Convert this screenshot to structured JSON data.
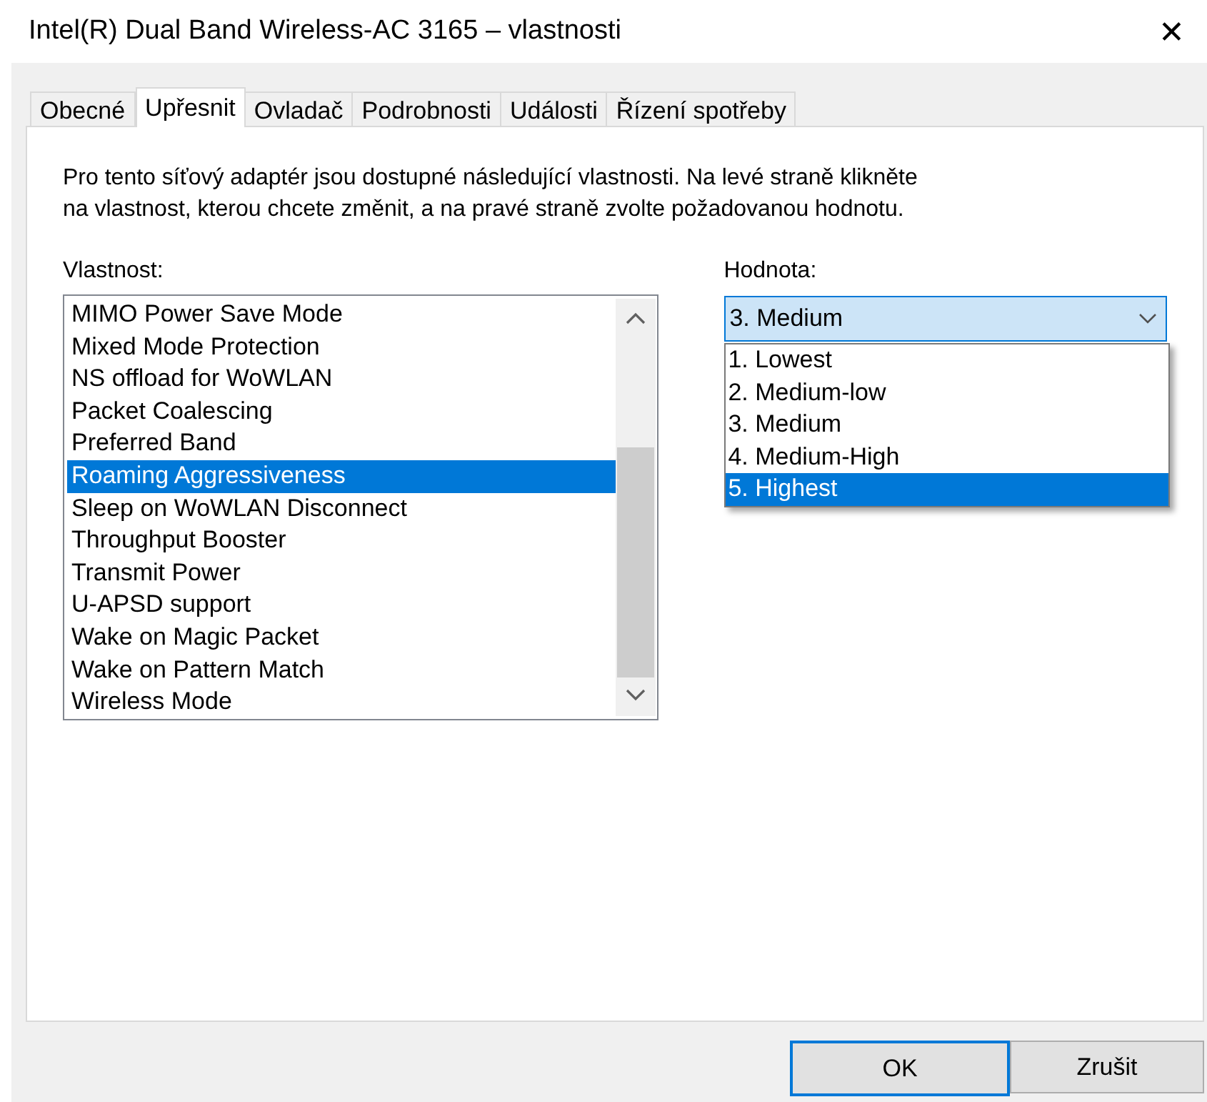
{
  "window": {
    "title": "Intel(R) Dual Band Wireless-AC 3165 – vlastnosti",
    "close": "✕"
  },
  "tabs": [
    {
      "label": "Obecné",
      "selected": false
    },
    {
      "label": "Upřesnit",
      "selected": true
    },
    {
      "label": "Ovladač",
      "selected": false
    },
    {
      "label": "Podrobnosti",
      "selected": false
    },
    {
      "label": "Události",
      "selected": false
    },
    {
      "label": "Řízení spotřeby",
      "selected": false
    }
  ],
  "description": "Pro tento síťový adaptér jsou dostupné následující vlastnosti. Na levé straně klikněte na vlastnost, kterou chcete změnit, a na pravé straně zvolte požadovanou hodnotu.",
  "property_list": {
    "label": "Vlastnost:",
    "items": [
      {
        "label": "MIMO Power Save Mode",
        "selected": false
      },
      {
        "label": "Mixed Mode Protection",
        "selected": false
      },
      {
        "label": "NS offload for WoWLAN",
        "selected": false
      },
      {
        "label": "Packet Coalescing",
        "selected": false
      },
      {
        "label": "Preferred Band",
        "selected": false
      },
      {
        "label": "Roaming Aggressiveness",
        "selected": true
      },
      {
        "label": "Sleep on WoWLAN Disconnect",
        "selected": false
      },
      {
        "label": "Throughput Booster",
        "selected": false
      },
      {
        "label": "Transmit Power",
        "selected": false
      },
      {
        "label": "U-APSD support",
        "selected": false
      },
      {
        "label": "Wake on Magic Packet",
        "selected": false
      },
      {
        "label": "Wake on Pattern Match",
        "selected": false
      },
      {
        "label": "Wireless Mode",
        "selected": false
      }
    ]
  },
  "value": {
    "label": "Hodnota:",
    "current": "3. Medium",
    "expanded": true,
    "options": [
      {
        "label": "1. Lowest",
        "highlighted": false
      },
      {
        "label": "2. Medium-low",
        "highlighted": false
      },
      {
        "label": "3. Medium",
        "highlighted": false
      },
      {
        "label": "4. Medium-High",
        "highlighted": false
      },
      {
        "label": "5. Highest",
        "highlighted": true
      }
    ]
  },
  "buttons": [
    {
      "label": "OK",
      "default": true
    },
    {
      "label": "Zrušit",
      "default": false
    }
  ]
}
